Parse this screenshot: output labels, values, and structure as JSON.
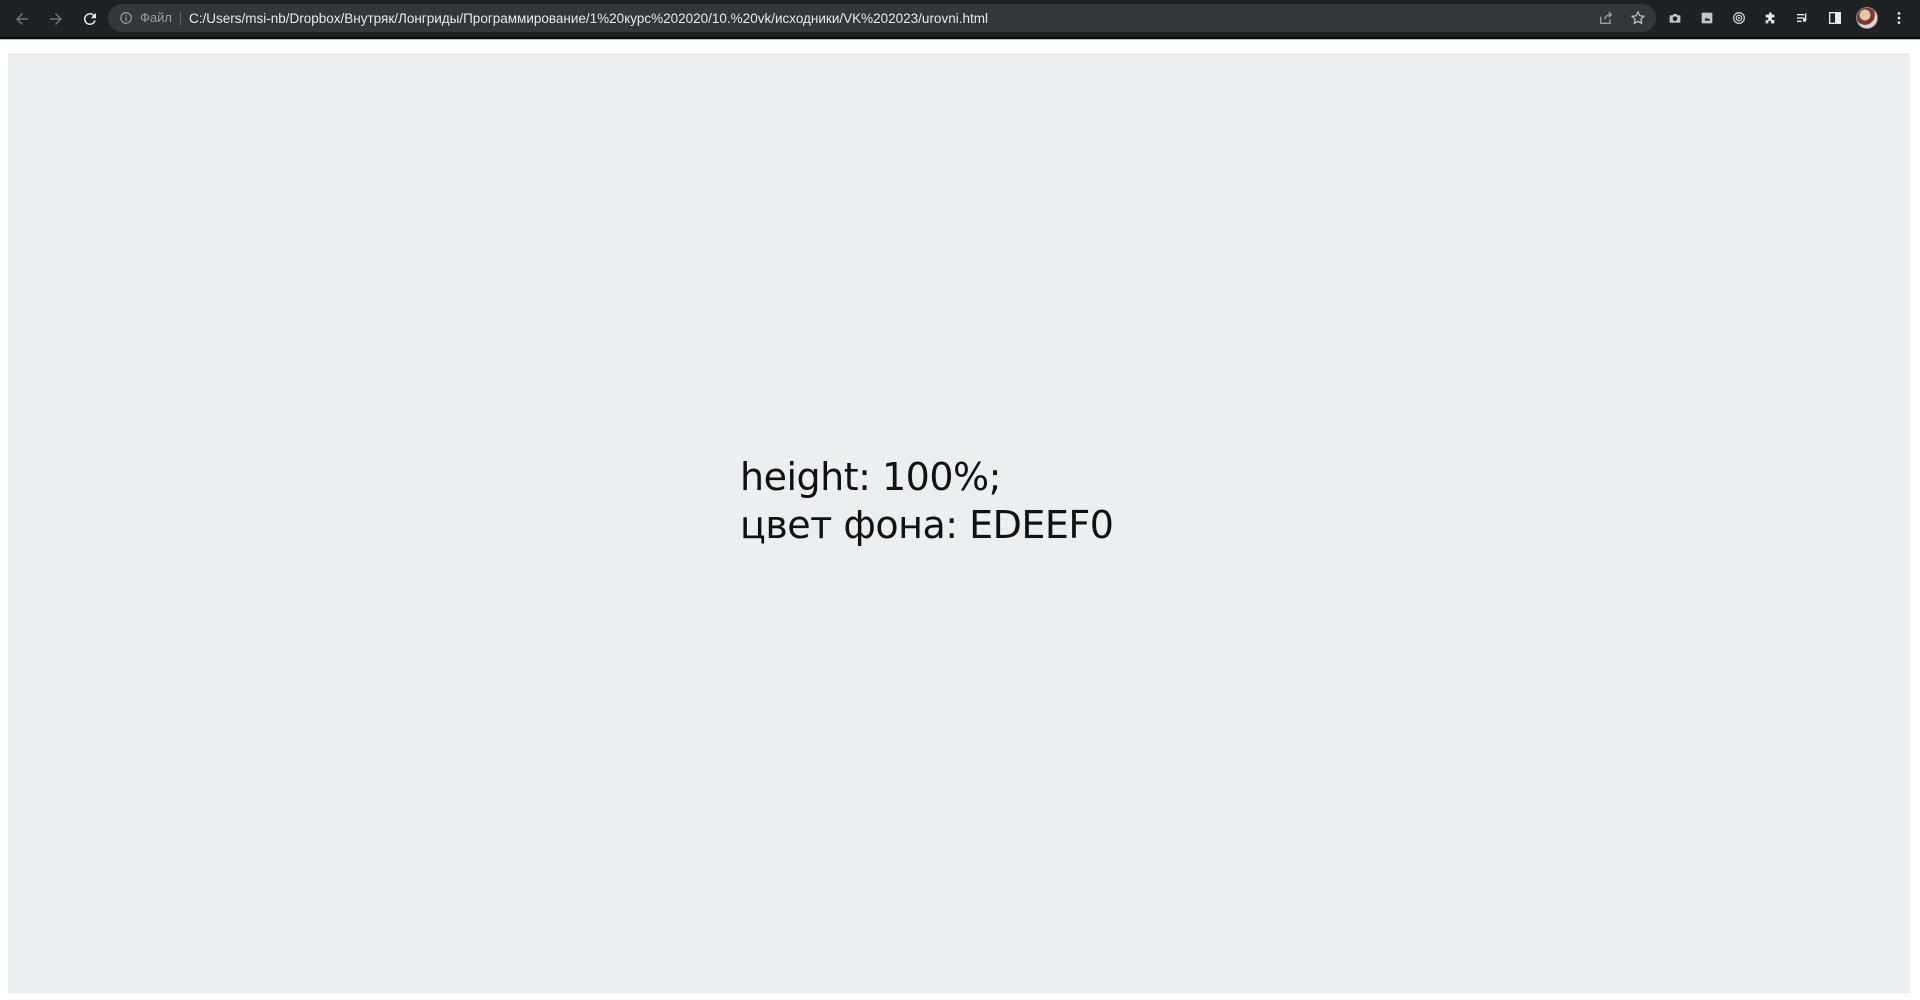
{
  "browser": {
    "address_prefix": "Файл",
    "url": "C:/Users/msi-nb/Dropbox/Внутряк/Лонгриды/Программирование/1%20курс%202020/10.%20vk/исходники/VK%202023/urovni.html",
    "icons": [
      "back-arrow-icon",
      "forward-arrow-icon",
      "reload-icon",
      "info-icon",
      "share-icon",
      "star-icon",
      "camera-icon",
      "extension-square-icon",
      "target-icon",
      "puzzle-icon",
      "reading-list-icon",
      "side-panel-icon",
      "avatar",
      "more-menu-icon"
    ]
  },
  "page": {
    "line1": "height: 100%;",
    "line2": "цвет фона: EDEEF0",
    "background_color": "#EDEEF0"
  }
}
